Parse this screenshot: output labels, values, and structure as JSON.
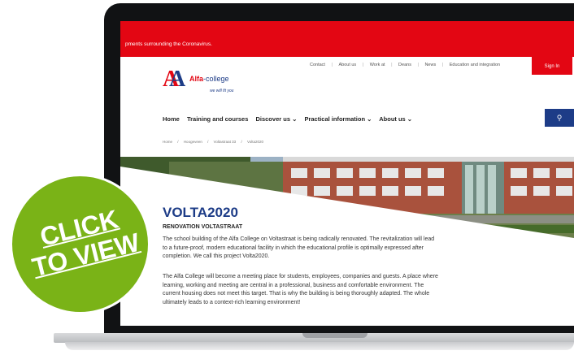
{
  "alert": {
    "text": "pments surrounding the Coronavirus."
  },
  "top_nav": {
    "items": [
      "Contact",
      "About us",
      "Work at",
      "Deans",
      "News",
      "Education and integration"
    ],
    "separator": "|",
    "sign_in": "Sign In"
  },
  "logo": {
    "name_main": "Alfa",
    "name_suffix": "-college",
    "tagline": "we will fit you"
  },
  "main_nav": {
    "items": [
      "Home",
      "Training and courses",
      "Discover us ⌄",
      "Practical information ⌄",
      "About us ⌄"
    ]
  },
  "breadcrumb": {
    "items": [
      "Home",
      "/",
      "Hoogeveen",
      "/",
      "Voltastraat 33",
      "/",
      "Volta2020"
    ]
  },
  "content": {
    "title": "VOLTA2020",
    "subtitle": "RENOVATION VOLTASTRAAT",
    "para1": "The school building of the Alfa College on Voltastraat is being radically renovated. The revitalization will lead to a future-proof, modern educational facility in which the educational profile is optimally expressed after completion. We call this project Volta2020.",
    "para2": "The Alfa College will become a meeting place for students, employees, companies and guests. A place where learning, working and meeting are central in a professional, business and comfortable environment. The current housing does not meet this target. That is why the building is being thoroughly adapted. The whole ultimately leads to a context-rich learning environment!"
  },
  "badge": {
    "line1": "CLICK",
    "line2": "TO VIEW"
  },
  "colors": {
    "brand_red": "#e30613",
    "brand_blue": "#1d3c87",
    "badge_green": "#7ab317"
  }
}
